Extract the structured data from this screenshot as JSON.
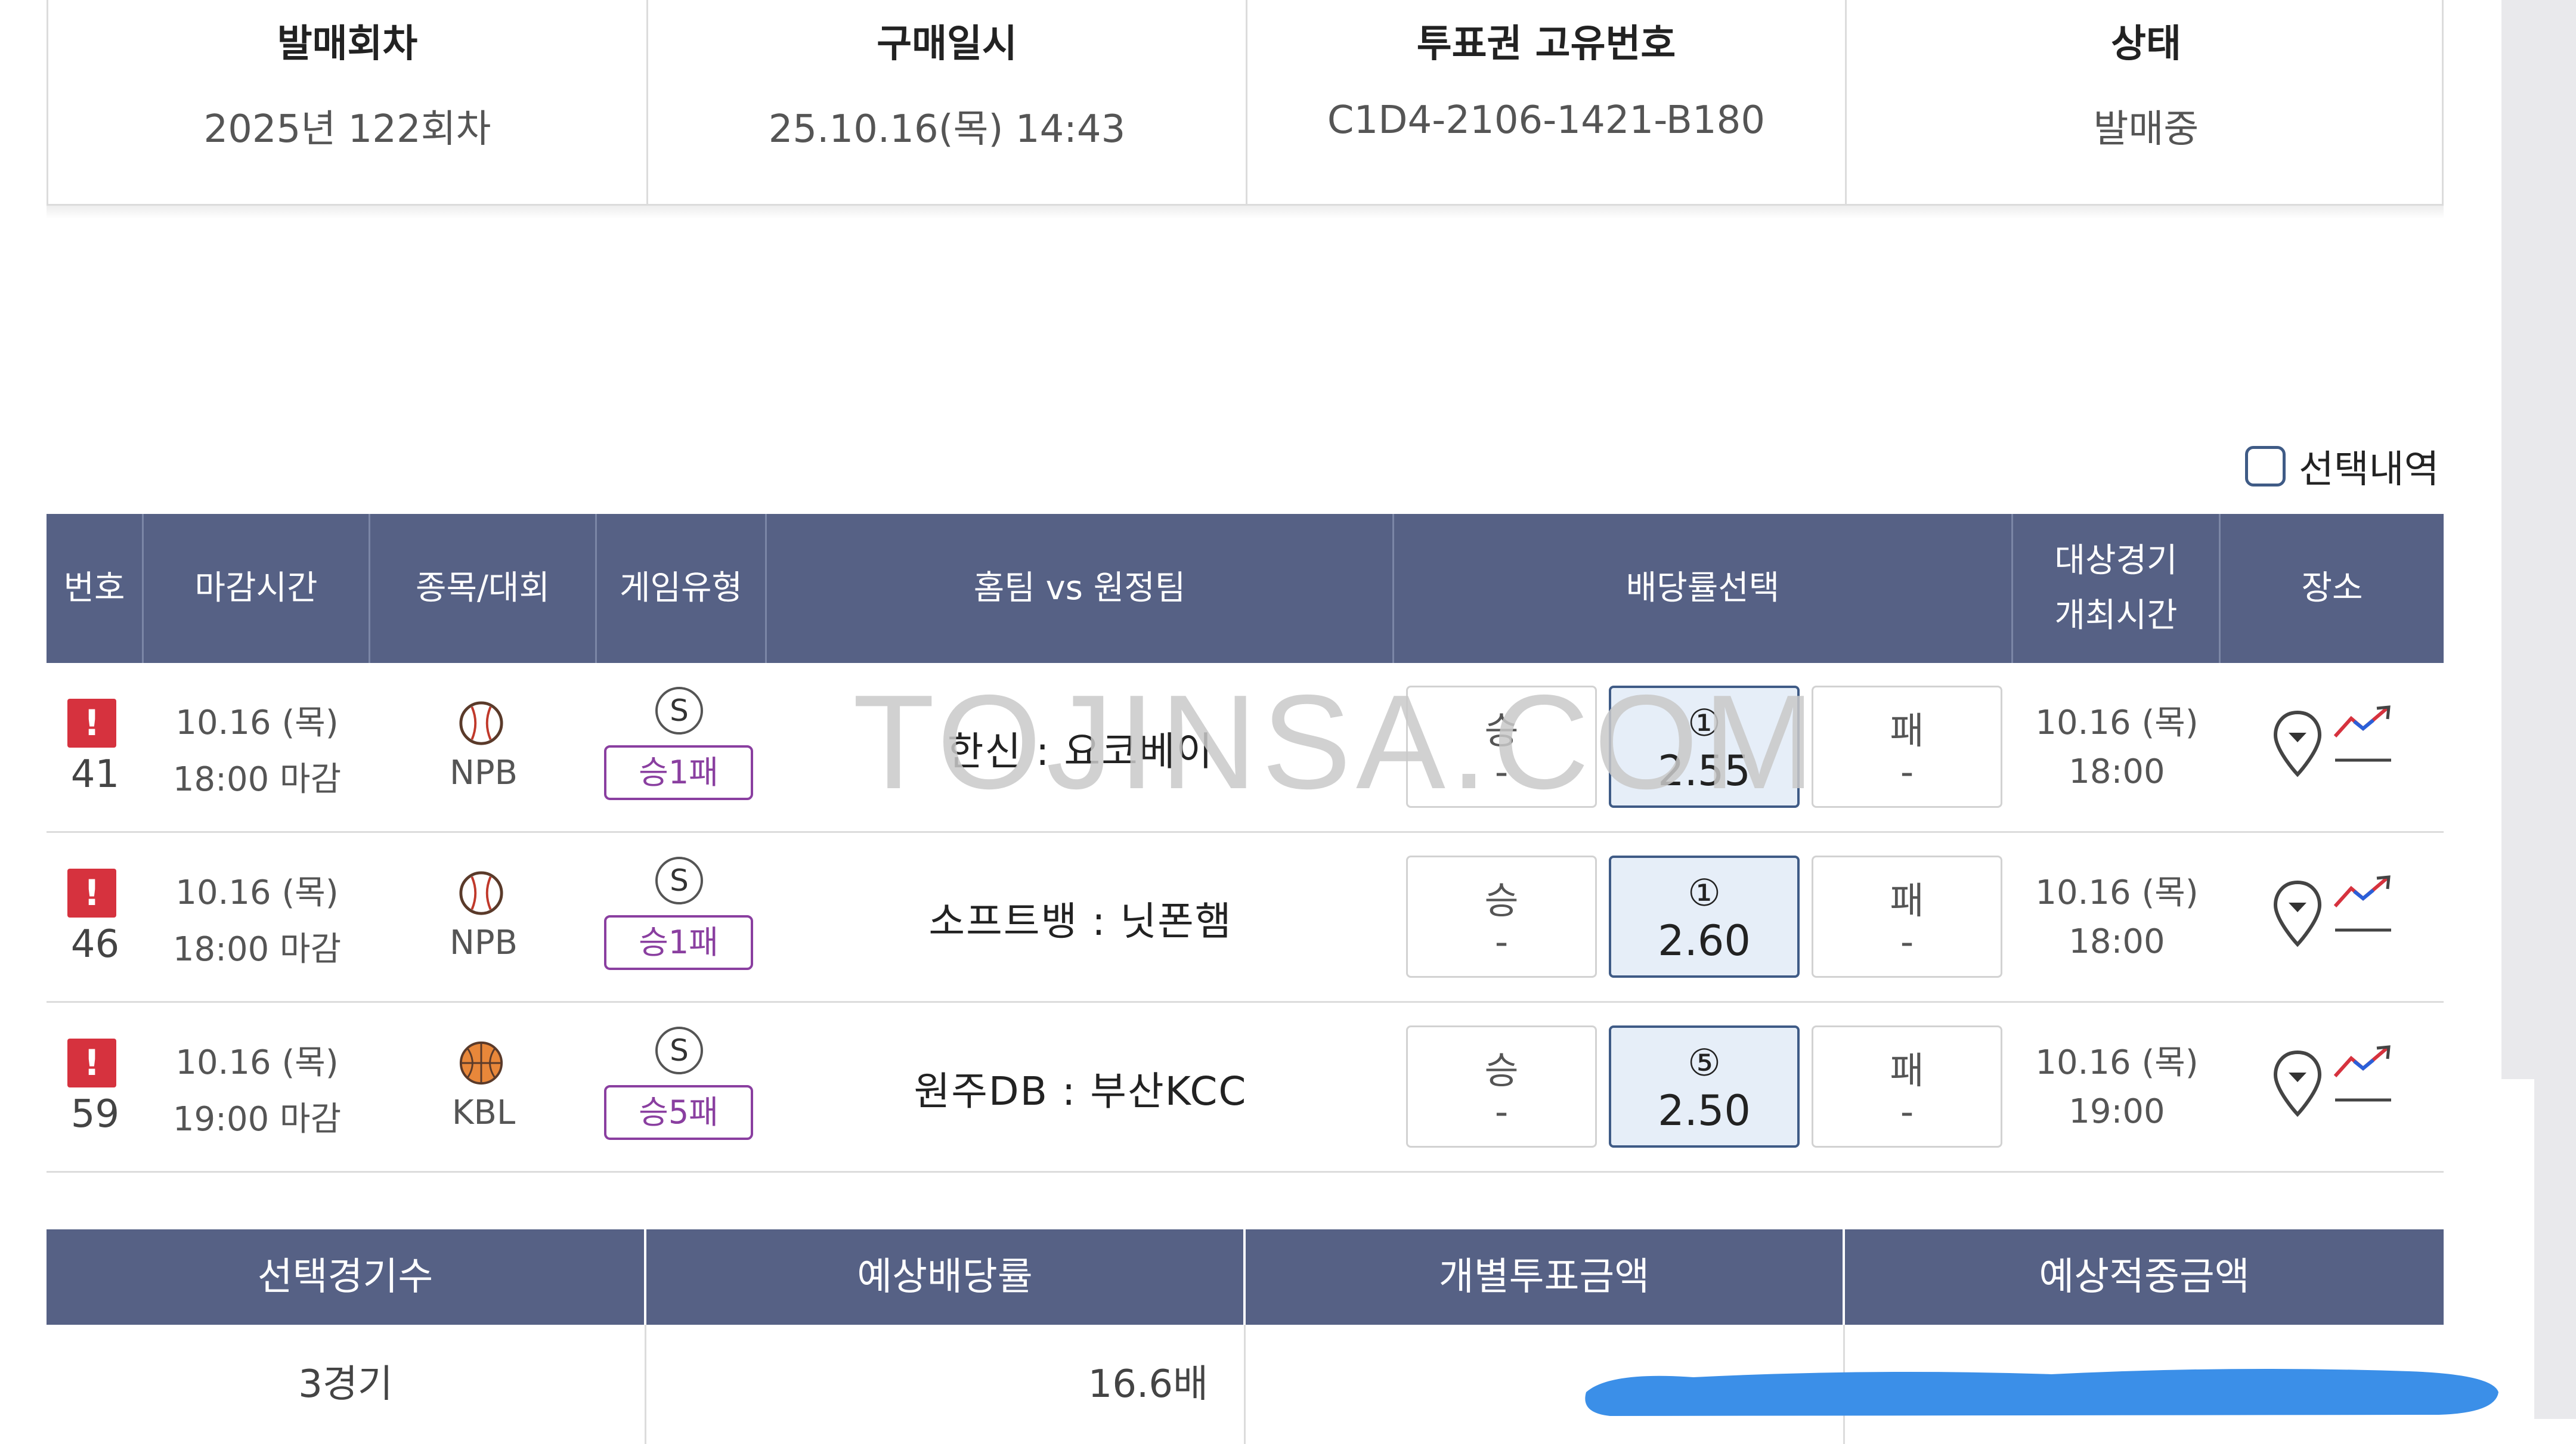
{
  "info": [
    {
      "label": "발매회차",
      "value": "2025년 122회차"
    },
    {
      "label": "구매일시",
      "value": "25.10.16(목) 14:43"
    },
    {
      "label": "투표권 고유번호",
      "value": "C1D4-2106-1421-B180"
    },
    {
      "label": "상태",
      "value": "발매중"
    }
  ],
  "selection_toggle": {
    "label": "선택내역",
    "checked": false
  },
  "table_headers": [
    "번호",
    "마감시간",
    "종목/대회",
    "게임유형",
    "홈팀 vs 원정팀",
    "배당률선택",
    "대상경기\n개최시간",
    "장소"
  ],
  "watermark": "TOJINSA.COM",
  "games": [
    {
      "number": "41",
      "deadline_date": "10.16 (목)",
      "deadline_time": "18:00 마감",
      "sport_icon": "baseball-icon",
      "league": "NPB",
      "badge": "S",
      "game_type": "승1패",
      "match": "한신 : 요코베이",
      "odds": [
        {
          "top": "승",
          "bottom": "-",
          "selected": false
        },
        {
          "top": "①",
          "bottom": "2.55",
          "selected": true
        },
        {
          "top": "패",
          "bottom": "-",
          "selected": false
        }
      ],
      "match_date": "10.16 (목)",
      "match_time": "18:00"
    },
    {
      "number": "46",
      "deadline_date": "10.16 (목)",
      "deadline_time": "18:00 마감",
      "sport_icon": "baseball-icon",
      "league": "NPB",
      "badge": "S",
      "game_type": "승1패",
      "match": "소프트뱅 : 닛폰햄",
      "odds": [
        {
          "top": "승",
          "bottom": "-",
          "selected": false
        },
        {
          "top": "①",
          "bottom": "2.60",
          "selected": true
        },
        {
          "top": "패",
          "bottom": "-",
          "selected": false
        }
      ],
      "match_date": "10.16 (목)",
      "match_time": "18:00"
    },
    {
      "number": "59",
      "deadline_date": "10.16 (목)",
      "deadline_time": "19:00 마감",
      "sport_icon": "basketball-icon",
      "league": "KBL",
      "badge": "S",
      "game_type": "승5패",
      "match": "원주DB : 부산KCC",
      "odds": [
        {
          "top": "승",
          "bottom": "-",
          "selected": false
        },
        {
          "top": "⑤",
          "bottom": "2.50",
          "selected": true
        },
        {
          "top": "패",
          "bottom": "-",
          "selected": false
        }
      ],
      "match_date": "10.16 (목)",
      "match_time": "19:00"
    }
  ],
  "summary": {
    "headers": [
      "선택경기수",
      "예상배당률",
      "개별투표금액",
      "예상적중금액"
    ],
    "values": [
      "3경기",
      "16.6배",
      "",
      ""
    ]
  },
  "colors": {
    "header_bg": "#566185",
    "alert": "#d6323e",
    "game_type": "#8a3fa0",
    "selected_odds_bg": "#e6eef8",
    "redaction": "#3b8fe8"
  }
}
